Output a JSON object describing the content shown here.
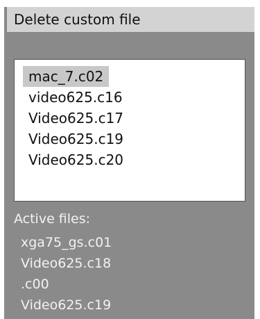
{
  "dialog": {
    "title": "Delete custom file"
  },
  "custom_files": {
    "selected_index": 0,
    "items": [
      "mac_7.c02",
      "video625.c16",
      "Video625.c17",
      "Video625.c19",
      "Video625.c20"
    ]
  },
  "active_files": {
    "label": "Active files:",
    "items": [
      "xga75_gs.c01",
      "Video625.c18",
      ".c00",
      "Video625.c19"
    ]
  },
  "colors": {
    "panel_background": "#8a8a8a",
    "title_background": "#d3d3d3",
    "selection_highlight": "#c8c8c8",
    "listbox_background": "#ffffff",
    "active_text": "#f2f2f2"
  }
}
